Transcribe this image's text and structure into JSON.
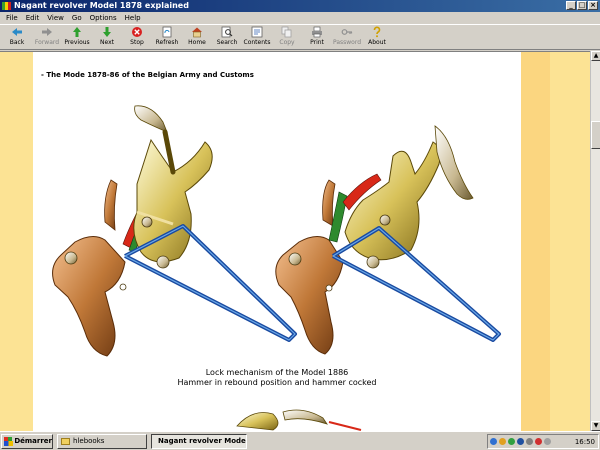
{
  "window": {
    "title": "Nagant revolver Model 1878 explained",
    "buttons": [
      "_",
      "□",
      "×"
    ]
  },
  "menu": {
    "items": [
      "File",
      "Edit",
      "View",
      "Go",
      "Options",
      "Help"
    ]
  },
  "toolbar": {
    "back": "Back",
    "forward": "Forward",
    "previous": "Previous",
    "next": "Next",
    "stop": "Stop",
    "refresh": "Refresh",
    "home": "Home",
    "search": "Search",
    "contents": "Contents",
    "copy": "Copy",
    "print": "Print",
    "password": "Password",
    "about": "About"
  },
  "page": {
    "heading": "- The Mode 1878-86 of the Belgian Army and Customs",
    "caption_line1": "Lock mechanism of the Model 1886",
    "caption_line2": "Hammer in rebound position and hammer cocked"
  },
  "taskbar": {
    "start": "Démarrer",
    "task1": "hlebooks",
    "task2": "Nagant revolver Model...",
    "clock": "16:50"
  }
}
